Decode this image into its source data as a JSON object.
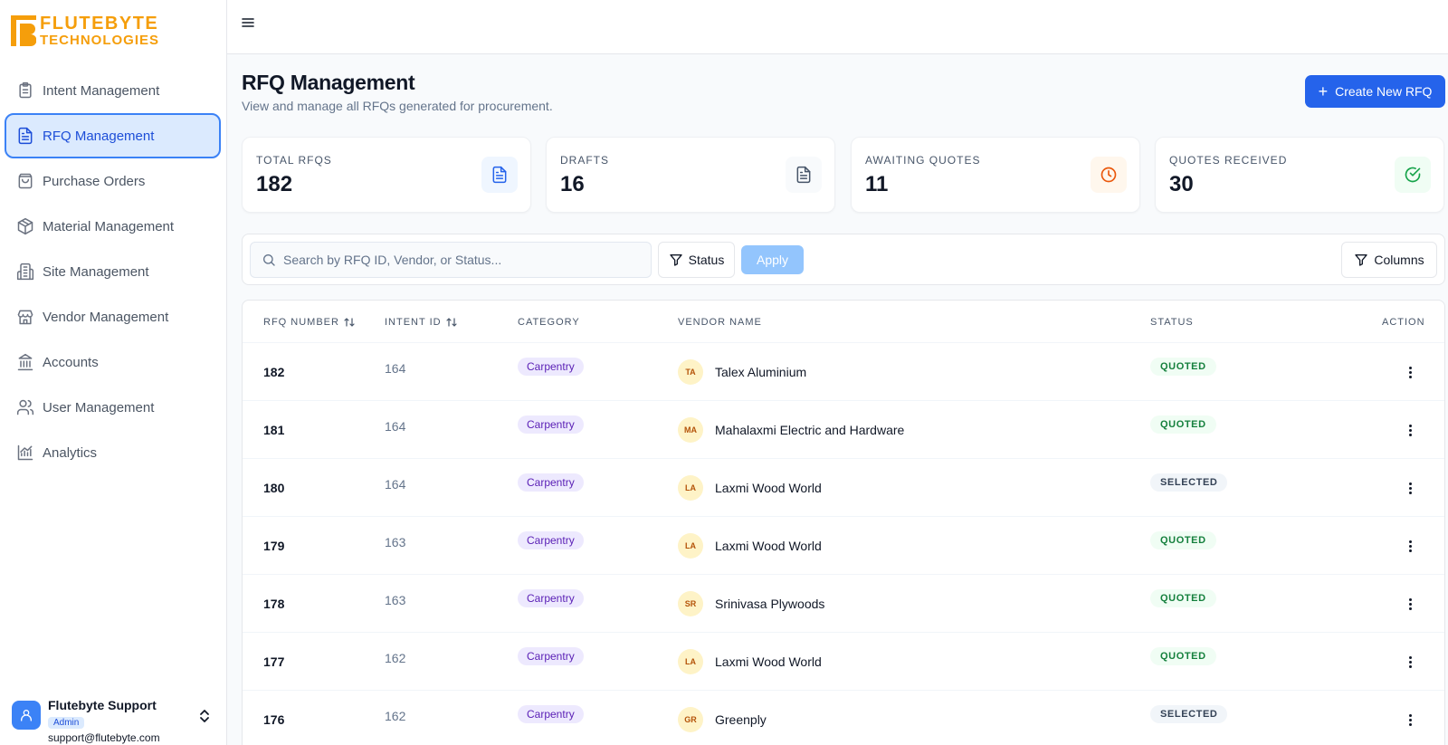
{
  "brand": {
    "line1": "FLUTEBYTE",
    "line2": "TECHNOLOGIES",
    "color": "#f59e0b"
  },
  "sidebar": {
    "items": [
      {
        "label": "Intent Management",
        "icon": "clipboard-list-icon"
      },
      {
        "label": "RFQ Management",
        "icon": "file-text-icon",
        "active": true
      },
      {
        "label": "Purchase Orders",
        "icon": "shopping-bag-icon"
      },
      {
        "label": "Material Management",
        "icon": "package-icon"
      },
      {
        "label": "Site Management",
        "icon": "building-icon"
      },
      {
        "label": "Vendor Management",
        "icon": "store-icon"
      },
      {
        "label": "Accounts",
        "icon": "landmark-icon"
      },
      {
        "label": "User Management",
        "icon": "users-icon"
      },
      {
        "label": "Analytics",
        "icon": "chart-line-icon"
      }
    ],
    "user": {
      "name": "Flutebyte Support",
      "role": "Admin",
      "email": "support@flutebyte.com"
    }
  },
  "header": {
    "title": "RFQ Management",
    "subtitle": "View and manage all RFQs generated for procurement.",
    "create_label": "Create New RFQ"
  },
  "stats": [
    {
      "label": "TOTAL RFQS",
      "value": "182",
      "icon": "file-text-icon",
      "color": "#2563eb",
      "bg": "#eff6ff"
    },
    {
      "label": "DRAFTS",
      "value": "16",
      "icon": "file-text-icon",
      "color": "#475569",
      "bg": "#f8fafc"
    },
    {
      "label": "AWAITING QUOTES",
      "value": "11",
      "icon": "clock-icon",
      "color": "#ea580c",
      "bg": "#fff7ed"
    },
    {
      "label": "QUOTES RECEIVED",
      "value": "30",
      "icon": "check-circle-icon",
      "color": "#16a34a",
      "bg": "#f0fdf4"
    }
  ],
  "filters": {
    "search_placeholder": "Search by RFQ ID, Vendor, or Status...",
    "search_value": "",
    "status_label": "Status",
    "apply_label": "Apply",
    "columns_label": "Columns"
  },
  "table": {
    "headers": {
      "rfq_number": "RFQ NUMBER",
      "intent_id": "INTENT ID",
      "category": "CATEGORY",
      "vendor_name": "VENDOR NAME",
      "status": "STATUS",
      "action": "ACTION"
    },
    "rows": [
      {
        "rfq": "182",
        "intent": "164",
        "category": "Carpentry",
        "initials": "TA",
        "vendor": "Talex Aluminium",
        "status": "QUOTED"
      },
      {
        "rfq": "181",
        "intent": "164",
        "category": "Carpentry",
        "initials": "MA",
        "vendor": "Mahalaxmi Electric and Hardware",
        "status": "QUOTED"
      },
      {
        "rfq": "180",
        "intent": "164",
        "category": "Carpentry",
        "initials": "LA",
        "vendor": "Laxmi Wood World",
        "status": "SELECTED"
      },
      {
        "rfq": "179",
        "intent": "163",
        "category": "Carpentry",
        "initials": "LA",
        "vendor": "Laxmi Wood World",
        "status": "QUOTED"
      },
      {
        "rfq": "178",
        "intent": "163",
        "category": "Carpentry",
        "initials": "SR",
        "vendor": "Srinivasa Plywoods",
        "status": "QUOTED"
      },
      {
        "rfq": "177",
        "intent": "162",
        "category": "Carpentry",
        "initials": "LA",
        "vendor": "Laxmi Wood World",
        "status": "QUOTED"
      },
      {
        "rfq": "176",
        "intent": "162",
        "category": "Carpentry",
        "initials": "GR",
        "vendor": "Greenply",
        "status": "SELECTED"
      }
    ]
  },
  "colors": {
    "primary": "#2563eb",
    "active_bg": "#dbeafe",
    "active_border": "#3b82f6"
  }
}
